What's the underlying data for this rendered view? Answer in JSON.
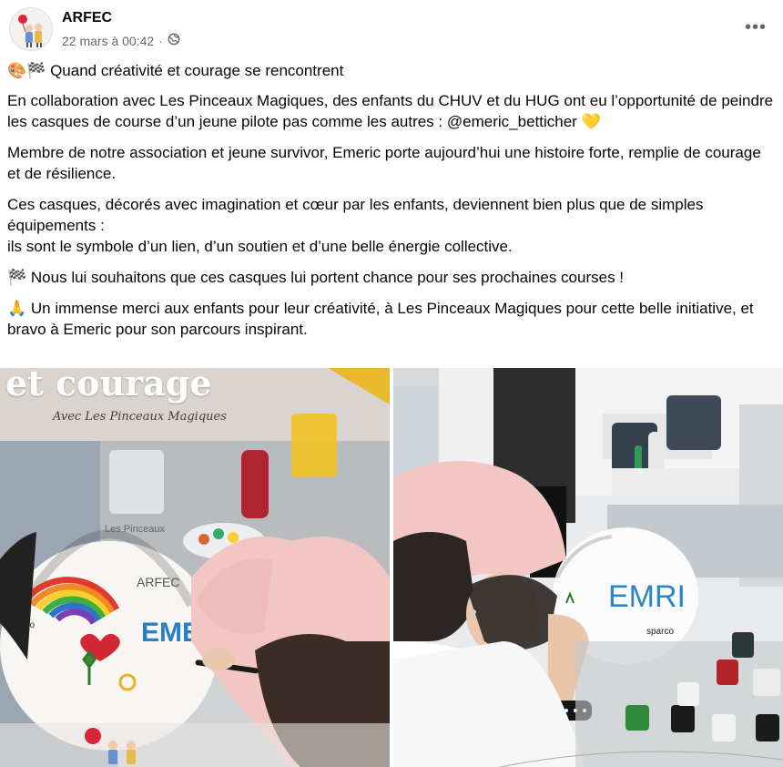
{
  "post": {
    "author": "ARFEC",
    "timestamp": "22 mars à 00:42",
    "separator": "·",
    "privacy_icon": "globe-icon",
    "more_icon": "more-horizontal-icon",
    "more_label": "•••"
  },
  "text": {
    "headline_emojis": "🎨🏁",
    "headline": "Quand créativité et courage se rencontrent",
    "p1_part1": "En collaboration avec Les Pinceaux Magiques, des enfants du CHUV et du HUG ont eu l’opportunité de peindre les casques de course d’un jeune pilote pas comme les autres : ",
    "p1_mention": "@emeric_betticher",
    "p1_emoji": "💛",
    "p2": "Membre de notre association et jeune survivor, Emeric porte aujourd’hui une histoire forte, remplie de courage et de résilience.",
    "p3_line1": "Ces casques, décorés avec imagination et cœur par les enfants, deviennent bien plus que de simples équipements :",
    "p3_line2": "ils sont le symbole d’un lien, d’un soutien et d’une belle énergie collective.",
    "p4_emoji": "🏁",
    "p4": "Nous lui souhaitons que ces casques lui portent chance pour ses prochaines courses !",
    "p5_emoji": "🙏",
    "p5": "Un immense merci aux enfants pour leur créativité, à Les Pinceaux Magiques pour cette belle initiative, et bravo à Emeric pour son parcours inspirant."
  },
  "images": {
    "left": {
      "overlay_title": "et courage",
      "overlay_subtitle": "Avec Les Pinceaux Magiques",
      "helmet_text": "EMEI",
      "helmet_text_small": "ARFEC",
      "helmet_text_small2": "Les Pinceaux",
      "helmet_brand": "sparco"
    },
    "right": {
      "helmet_text": "EMRI",
      "helmet_brand": "sparco"
    }
  },
  "colors": {
    "text": "#050505",
    "meta": "#65676b",
    "background": "#ffffff"
  }
}
